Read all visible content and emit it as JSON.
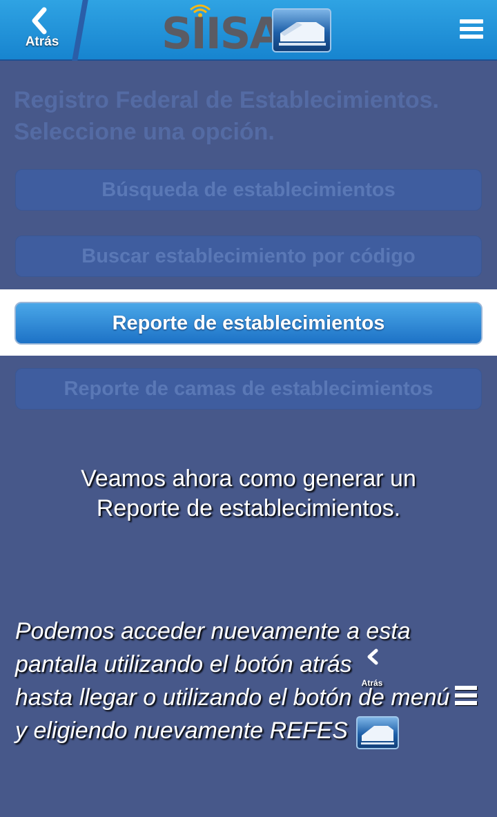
{
  "header": {
    "back_label": "Atrás",
    "logo_text": "SIISA",
    "menu_icon": "hamburger-menu-icon",
    "colors": {
      "bar": "#1f8fd9",
      "logo_text": "#5b5b63"
    }
  },
  "main": {
    "prompt": "Registro Federal de Establecimientos. Seleccione una opción.",
    "options": [
      {
        "label": "Búsqueda de establecimientos"
      },
      {
        "label": "Buscar establecimiento por código"
      },
      {
        "label": "Reporte de establecimientos"
      },
      {
        "label": "Reporte de camas de establecimientos"
      }
    ]
  },
  "overlay": {
    "caption_line1": "Veamos ahora como generar un",
    "caption_line2": "Reporte de establecimientos.",
    "tip": {
      "line1": "Podemos acceder nuevamente a esta",
      "line2": "pantalla utilizando el botón atrás",
      "back_icon_label": "Atrás",
      "line3": "hasta llegar o utilizando el botón de menú",
      "line4": "y eligiendo nuevamente REFES"
    },
    "colors": {
      "dim": "#47588a",
      "active_button": "#2b86d8"
    }
  }
}
